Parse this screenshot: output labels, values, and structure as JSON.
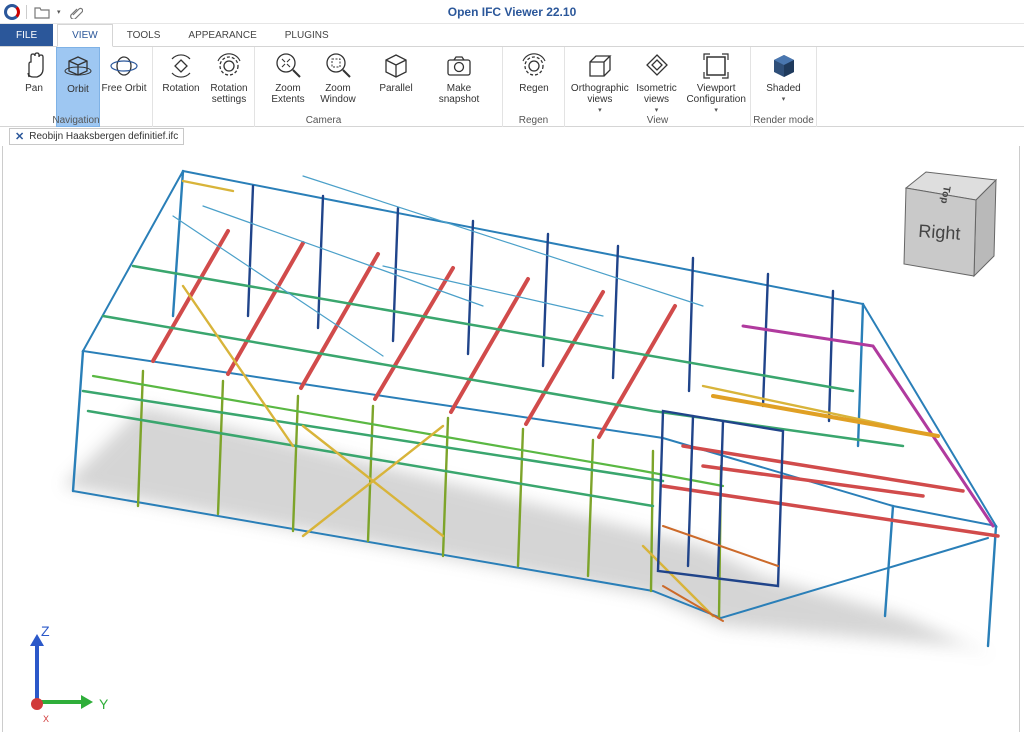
{
  "title": "Open IFC Viewer 22.10",
  "tabs": [
    {
      "label": "FILE"
    },
    {
      "label": "VIEW"
    },
    {
      "label": "TOOLS"
    },
    {
      "label": "APPEARANCE"
    },
    {
      "label": "PLUGINS"
    }
  ],
  "ribbon": {
    "navigation": {
      "label": "Navigation",
      "pan": "Pan",
      "orbit": "Orbit",
      "free_orbit": "Free Orbit"
    },
    "rotation": {
      "rotation": "Rotation",
      "rotation_settings": "Rotation\nsettings"
    },
    "camera": {
      "label": "Camera",
      "zoom_extents": "Zoom\nExtents",
      "zoom_window": "Zoom\nWindow",
      "parallel": "Parallel",
      "make_snapshot": "Make\nsnapshot"
    },
    "regen": {
      "label": "Regen",
      "regen": "Regen"
    },
    "view": {
      "label": "View",
      "orthographic": "Orthographic\nviews",
      "isometric": "Isometric\nviews",
      "viewport_config": "Viewport\nConfiguration"
    },
    "render": {
      "label": "Render mode",
      "shaded": "Shaded"
    }
  },
  "document_tab": "Reobijn Haaksbergen definitief.ifc",
  "navcube": {
    "front": "Right",
    "top": "Top"
  },
  "axes": {
    "z": "Z",
    "y": "Y",
    "x": "X"
  },
  "colors": {
    "accent": "#2b579a",
    "active": "#9ec7f2"
  }
}
